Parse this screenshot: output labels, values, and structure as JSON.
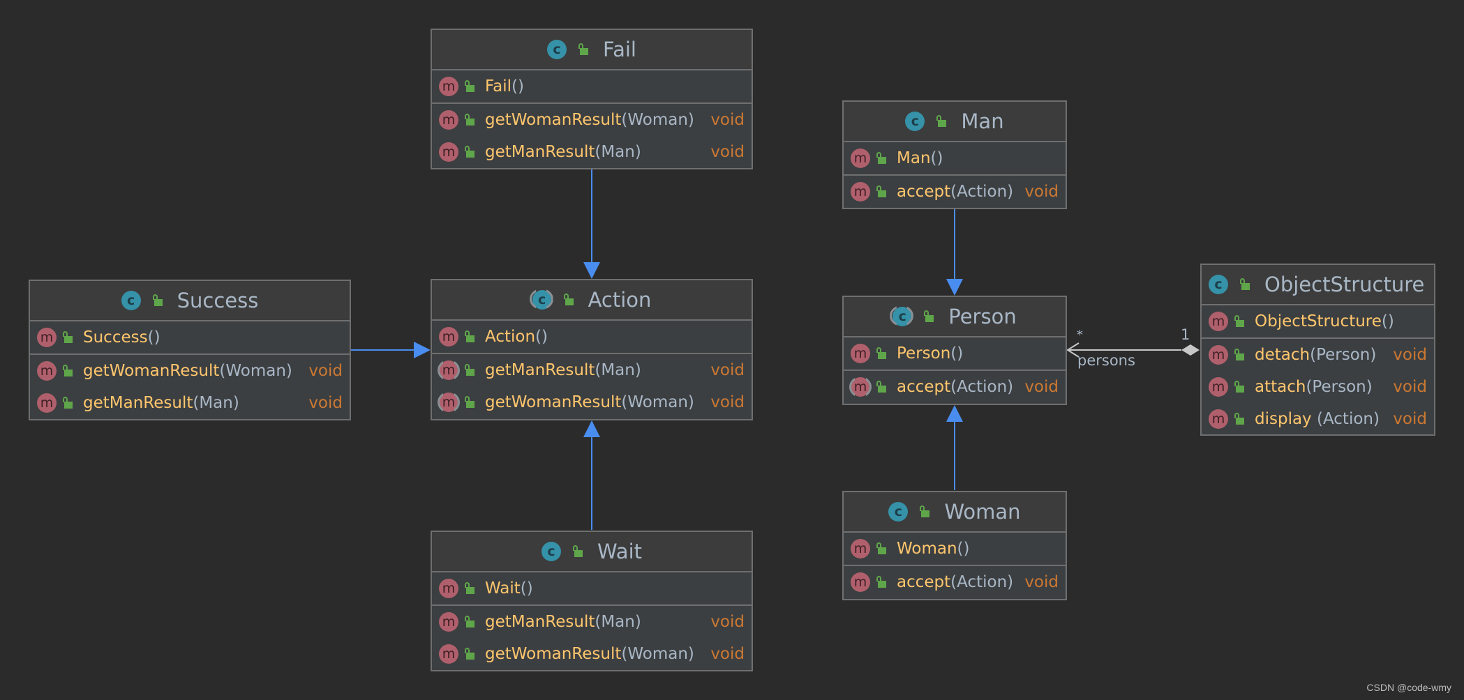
{
  "classes": {
    "fail": {
      "name": "Fail",
      "kind": "class",
      "constructor": {
        "name": "Fail",
        "params": "()"
      },
      "methods": [
        {
          "name": "getWomanResult",
          "params": "(Woman)",
          "return": "void"
        },
        {
          "name": "getManResult",
          "params": "(Man)",
          "return": "void"
        }
      ]
    },
    "action": {
      "name": "Action",
      "kind": "abstract-class",
      "constructor": {
        "name": "Action",
        "params": "()"
      },
      "methods": [
        {
          "name": "getManResult",
          "params": "(Man)",
          "return": "void",
          "abstract": true
        },
        {
          "name": "getWomanResult",
          "params": "(Woman)",
          "return": "void",
          "abstract": true
        }
      ]
    },
    "wait": {
      "name": "Wait",
      "kind": "class",
      "constructor": {
        "name": "Wait",
        "params": "()"
      },
      "methods": [
        {
          "name": "getManResult",
          "params": "(Man)",
          "return": "void"
        },
        {
          "name": "getWomanResult",
          "params": "(Woman)",
          "return": "void"
        }
      ]
    },
    "success": {
      "name": "Success",
      "kind": "class",
      "constructor": {
        "name": "Success",
        "params": "()"
      },
      "methods": [
        {
          "name": "getWomanResult",
          "params": "(Woman)",
          "return": "void"
        },
        {
          "name": "getManResult",
          "params": "(Man)",
          "return": "void"
        }
      ]
    },
    "man": {
      "name": "Man",
      "kind": "class",
      "constructor": {
        "name": "Man",
        "params": "()"
      },
      "methods": [
        {
          "name": "accept",
          "params": "(Action)",
          "return": "void"
        }
      ]
    },
    "person": {
      "name": "Person",
      "kind": "abstract-class",
      "constructor": {
        "name": "Person",
        "params": "()"
      },
      "methods": [
        {
          "name": "accept",
          "params": "(Action)",
          "return": "void",
          "abstract": true
        }
      ]
    },
    "woman": {
      "name": "Woman",
      "kind": "class",
      "constructor": {
        "name": "Woman",
        "params": "()"
      },
      "methods": [
        {
          "name": "accept",
          "params": "(Action)",
          "return": "void"
        }
      ]
    },
    "objectStructure": {
      "name": "ObjectStructure",
      "kind": "class",
      "constructor": {
        "name": "ObjectStructure",
        "params": "()"
      },
      "methods": [
        {
          "name": "detach",
          "params": "(Person)",
          "return": "void"
        },
        {
          "name": "attach",
          "params": "(Person)",
          "return": "void"
        },
        {
          "name": "display",
          "params": " (Action)",
          "return": "void"
        }
      ]
    }
  },
  "relations": [
    {
      "from": "Fail",
      "to": "Action",
      "type": "generalization"
    },
    {
      "from": "Success",
      "to": "Action",
      "type": "generalization"
    },
    {
      "from": "Wait",
      "to": "Action",
      "type": "generalization"
    },
    {
      "from": "Man",
      "to": "Person",
      "type": "generalization"
    },
    {
      "from": "Woman",
      "to": "Person",
      "type": "generalization"
    },
    {
      "from": "ObjectStructure",
      "to": "Person",
      "type": "aggregation",
      "role": "persons",
      "source_multiplicity": "1",
      "target_multiplicity": "*"
    }
  ],
  "icons": {
    "class": "c",
    "method": "m"
  },
  "colors": {
    "background": "#2b2b2b",
    "inheritance_arrow": "#4a8df0",
    "aggregation_line": "#c8c8c8",
    "method_name": "#ffc66d",
    "params": "#a9b7c6",
    "return_type": "#cc7832"
  },
  "watermark": "CSDN @code-wmy"
}
